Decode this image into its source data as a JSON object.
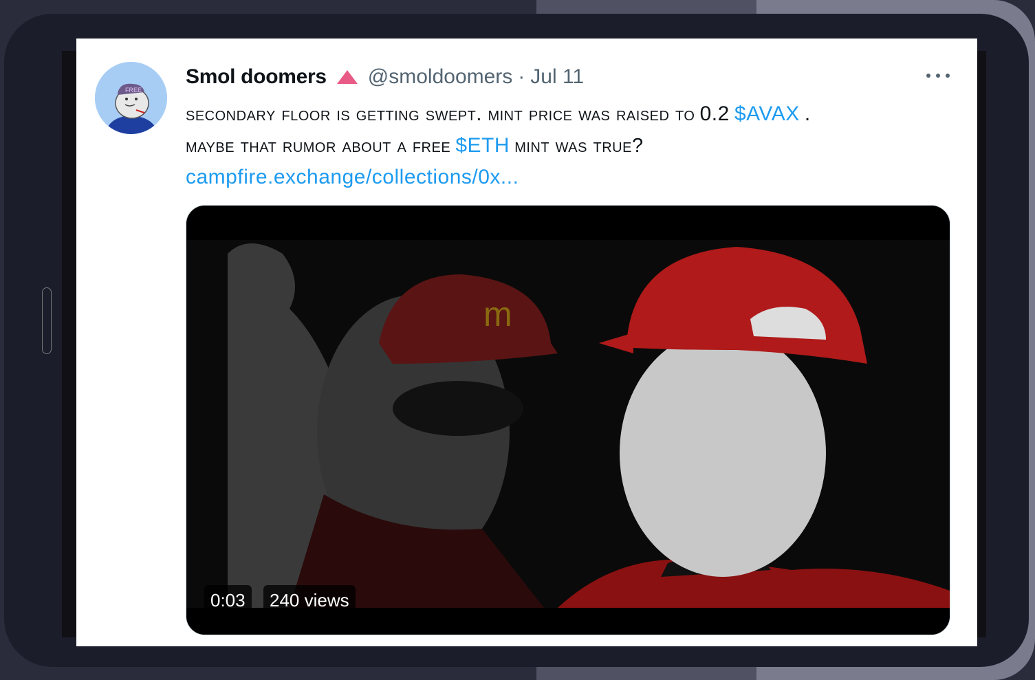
{
  "tweet": {
    "display_name": "Smol doomers",
    "badge_icon": "red-triangle-icon",
    "handle": "@smoldoomers",
    "separator": "·",
    "date": "Jul 11",
    "more_icon": "more-dots-icon",
    "text": {
      "part1": "Secondary floor is getting swept. Mint price was raised to",
      "price": "0.2",
      "cashtag_avax": "$AVAX",
      "part2": ".",
      "part3": "Maybe that rumor about a free",
      "cashtag_eth": "$ETH",
      "part4": "mint was true?",
      "url": "campfire.exchange/collections/0x..."
    },
    "media": {
      "type": "video",
      "duration": "0:03",
      "views": "240 views"
    }
  },
  "colors": {
    "link": "#1d9bf0",
    "name": "#0f1419",
    "secondary": "#536471",
    "badge": "#e0245e"
  }
}
